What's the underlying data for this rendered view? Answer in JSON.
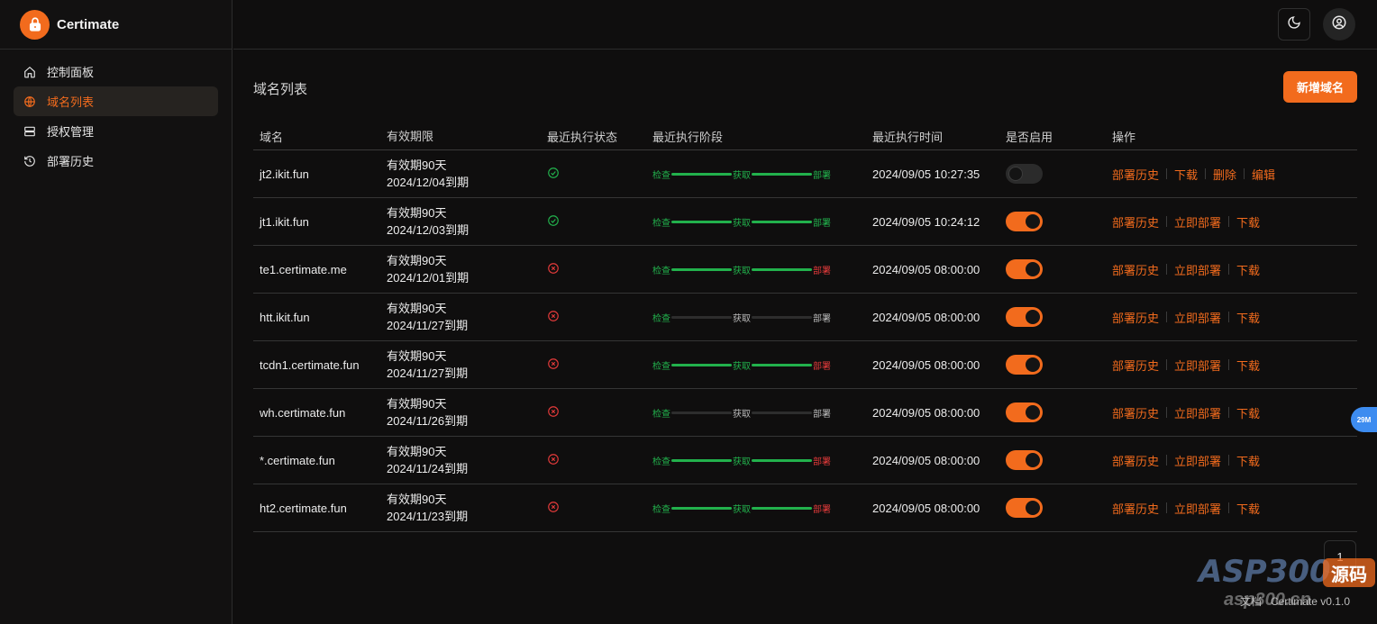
{
  "app": {
    "name": "Certimate"
  },
  "sidebar": {
    "items": [
      {
        "label": "控制面板",
        "icon": "home-icon",
        "active": false
      },
      {
        "label": "域名列表",
        "icon": "globe-icon",
        "active": true
      },
      {
        "label": "授权管理",
        "icon": "server-icon",
        "active": false
      },
      {
        "label": "部署历史",
        "icon": "history-icon",
        "active": false
      }
    ]
  },
  "header": {
    "theme_icon": "moon-icon",
    "user_icon": "user-circle-icon"
  },
  "main": {
    "title": "域名列表",
    "add_button": "新增域名",
    "columns": [
      "域名",
      "有效期限",
      "最近执行状态",
      "最近执行阶段",
      "最近执行时间",
      "是否启用",
      "操作"
    ],
    "rows": [
      {
        "domain": "jt2.ikit.fun",
        "valid": "有效期90天",
        "expire": "2024/12/04到期",
        "status": "success",
        "stages": [
          {
            "label": "检查",
            "state": "ok"
          },
          {
            "label": "获取",
            "state": "ok"
          },
          {
            "label": "部署",
            "state": "ok"
          }
        ],
        "time": "2024/09/05 10:27:35",
        "enabled": false,
        "ops": [
          "部署历史",
          "下载",
          "删除",
          "编辑"
        ]
      },
      {
        "domain": "jt1.ikit.fun",
        "valid": "有效期90天",
        "expire": "2024/12/03到期",
        "status": "success",
        "stages": [
          {
            "label": "检查",
            "state": "ok"
          },
          {
            "label": "获取",
            "state": "ok"
          },
          {
            "label": "部署",
            "state": "ok"
          }
        ],
        "time": "2024/09/05 10:24:12",
        "enabled": true,
        "ops": [
          "部署历史",
          "立即部署",
          "下载"
        ]
      },
      {
        "domain": "te1.certimate.me",
        "valid": "有效期90天",
        "expire": "2024/12/01到期",
        "status": "error",
        "stages": [
          {
            "label": "检查",
            "state": "ok"
          },
          {
            "label": "获取",
            "state": "ok"
          },
          {
            "label": "部署",
            "state": "err"
          }
        ],
        "time": "2024/09/05 08:00:00",
        "enabled": true,
        "ops": [
          "部署历史",
          "立即部署",
          "下载"
        ]
      },
      {
        "domain": "htt.ikit.fun",
        "valid": "有效期90天",
        "expire": "2024/11/27到期",
        "status": "error",
        "stages": [
          {
            "label": "检查",
            "state": "ok"
          },
          {
            "label": "获取",
            "state": "idle"
          },
          {
            "label": "部署",
            "state": "idle"
          }
        ],
        "time": "2024/09/05 08:00:00",
        "enabled": true,
        "ops": [
          "部署历史",
          "立即部署",
          "下载"
        ]
      },
      {
        "domain": "tcdn1.certimate.fun",
        "valid": "有效期90天",
        "expire": "2024/11/27到期",
        "status": "error",
        "stages": [
          {
            "label": "检查",
            "state": "ok"
          },
          {
            "label": "获取",
            "state": "ok"
          },
          {
            "label": "部署",
            "state": "err"
          }
        ],
        "time": "2024/09/05 08:00:00",
        "enabled": true,
        "ops": [
          "部署历史",
          "立即部署",
          "下载"
        ]
      },
      {
        "domain": "wh.certimate.fun",
        "valid": "有效期90天",
        "expire": "2024/11/26到期",
        "status": "error",
        "stages": [
          {
            "label": "检查",
            "state": "ok"
          },
          {
            "label": "获取",
            "state": "idle"
          },
          {
            "label": "部署",
            "state": "idle"
          }
        ],
        "time": "2024/09/05 08:00:00",
        "enabled": true,
        "ops": [
          "部署历史",
          "立即部署",
          "下载"
        ]
      },
      {
        "domain": "*.certimate.fun",
        "valid": "有效期90天",
        "expire": "2024/11/24到期",
        "status": "error",
        "stages": [
          {
            "label": "检查",
            "state": "ok"
          },
          {
            "label": "获取",
            "state": "ok"
          },
          {
            "label": "部署",
            "state": "err"
          }
        ],
        "time": "2024/09/05 08:00:00",
        "enabled": true,
        "ops": [
          "部署历史",
          "立即部署",
          "下载"
        ]
      },
      {
        "domain": "ht2.certimate.fun",
        "valid": "有效期90天",
        "expire": "2024/11/23到期",
        "status": "error",
        "stages": [
          {
            "label": "检查",
            "state": "ok"
          },
          {
            "label": "获取",
            "state": "ok"
          },
          {
            "label": "部署",
            "state": "err"
          }
        ],
        "time": "2024/09/05 08:00:00",
        "enabled": true,
        "ops": [
          "部署历史",
          "立即部署",
          "下载"
        ]
      }
    ],
    "pagination": {
      "current_page": "1"
    }
  },
  "footer": {
    "docs": "文档",
    "version": "Certimate v0.1.0"
  },
  "badge": "29M",
  "watermark": {
    "brand": "ASP300",
    "tag": "源码",
    "site": "asp300.cn"
  },
  "colors": {
    "accent": "#f26b1d",
    "success": "#22b14c",
    "error": "#e23a3a",
    "background": "#0f0e0e"
  }
}
